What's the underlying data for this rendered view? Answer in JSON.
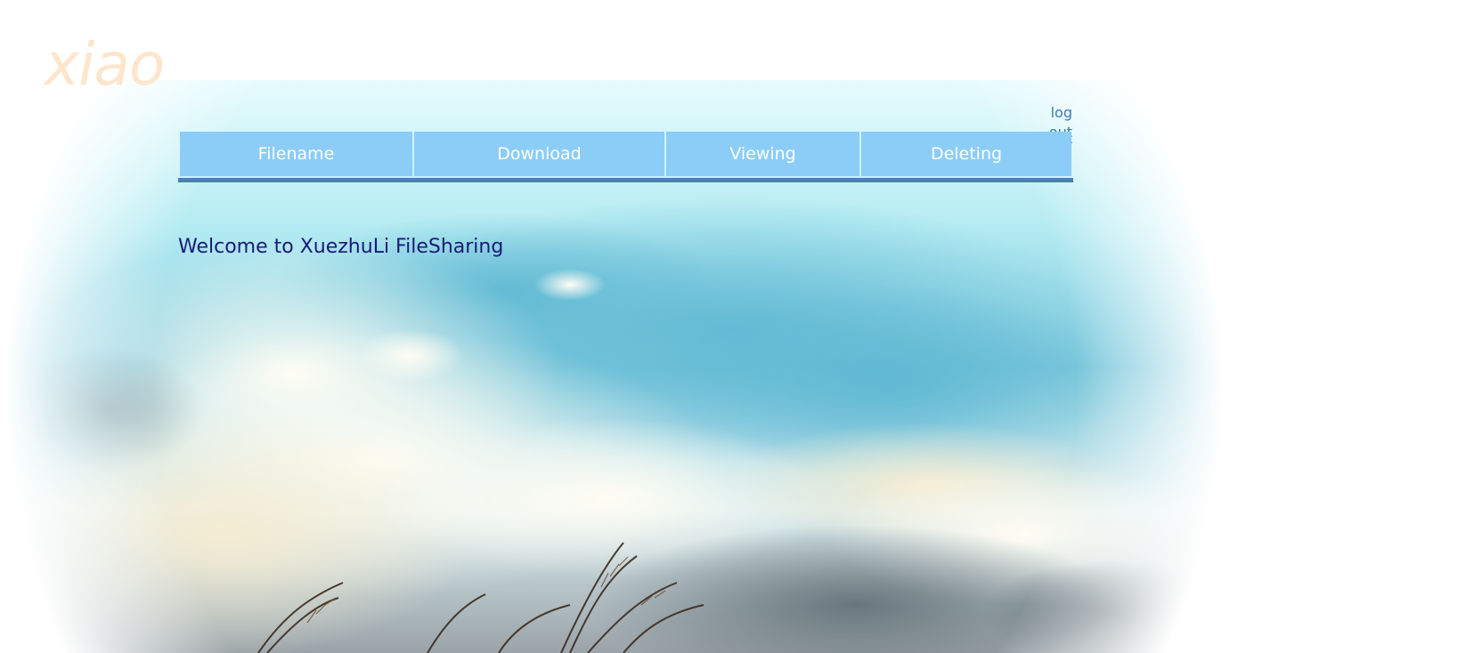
{
  "page": {
    "logo_text": "xiao",
    "logout_label": "log out",
    "welcome_text": "Welcome to XuezhuLi FileSharing"
  },
  "table": {
    "columns": [
      "Filename",
      "Download",
      "Viewing",
      "Deleting"
    ]
  },
  "colors": {
    "header_cell": "#8ccdf8",
    "header_text": "#ffffff",
    "header_rule": "#4a7fb8",
    "logo": "#fde6cc",
    "link": "#3b78b8",
    "welcome": "#1a1a78"
  },
  "background": {
    "description_icon": "sky-clouds-grass-photo"
  }
}
